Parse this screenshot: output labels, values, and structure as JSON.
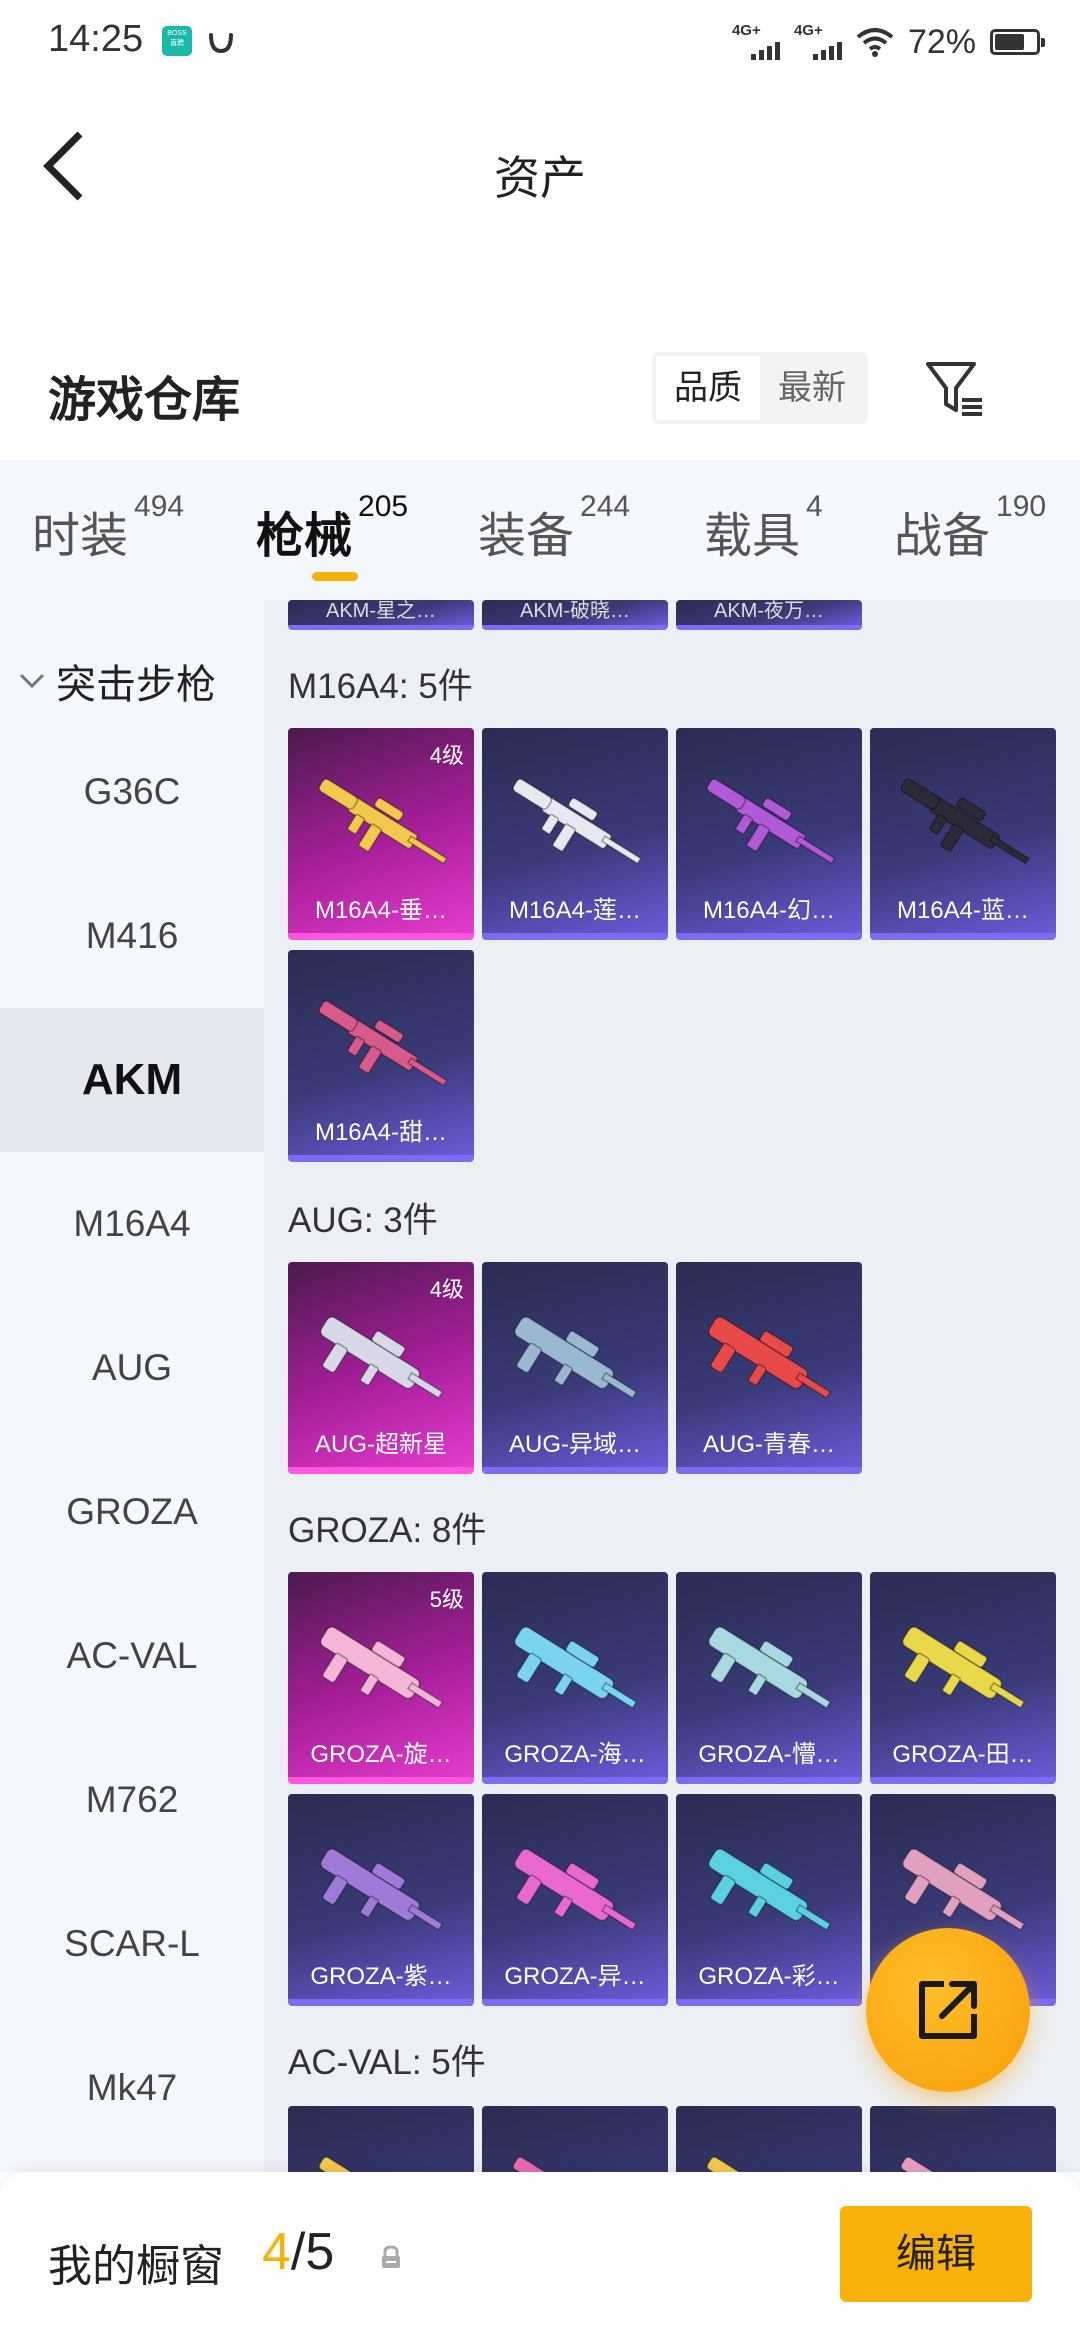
{
  "status_bar": {
    "time": "14:25",
    "app_icon_1": "BOSS直聘",
    "network_1": "4G+",
    "network_2": "4G+",
    "battery_percent": "72%",
    "battery_level": 0.72
  },
  "header": {
    "title": "资产",
    "back_icon": "chevron-left-icon"
  },
  "warehouse": {
    "title": "游戏仓库",
    "sort_options": [
      "品质",
      "最新"
    ],
    "selected_sort": "品质",
    "filter_icon": "filter-icon"
  },
  "tabs": [
    {
      "label": "时装",
      "count": "494"
    },
    {
      "label": "枪械",
      "count": "205"
    },
    {
      "label": "装备",
      "count": "244"
    },
    {
      "label": "载具",
      "count": "4"
    },
    {
      "label": "战备",
      "count": "190"
    }
  ],
  "active_tab": "枪械",
  "sidebar": {
    "category": "突击步枪",
    "items": [
      "G36C",
      "M416",
      "AKM",
      "M16A4",
      "AUG",
      "GROZA",
      "AC-VAL",
      "M762",
      "SCAR-L",
      "Mk47"
    ],
    "active": "AKM"
  },
  "content": {
    "top_partial": [
      "AKM-星之…",
      "AKM-破晓…",
      "AKM-夜万…"
    ],
    "sections": [
      {
        "title": "M16A4: 5件",
        "items": [
          {
            "name": "M16A4-垂…",
            "level": "4级",
            "rarity": "gold",
            "accent": "#f2c94c"
          },
          {
            "name": "M16A4-莲…",
            "level": "",
            "rarity": "purple",
            "accent": "#e8e8f0"
          },
          {
            "name": "M16A4-幻…",
            "level": "",
            "rarity": "purple",
            "accent": "#b05ad8"
          },
          {
            "name": "M16A4-蓝…",
            "level": "",
            "rarity": "purple",
            "accent": "#2c2a36"
          },
          {
            "name": "M16A4-甜…",
            "level": "",
            "rarity": "purple",
            "accent": "#d85a8a"
          }
        ]
      },
      {
        "title": "AUG: 3件",
        "items": [
          {
            "name": "AUG-超新星",
            "level": "4级",
            "rarity": "gold",
            "accent": "#d8d8e8"
          },
          {
            "name": "AUG-异域…",
            "level": "",
            "rarity": "purple",
            "accent": "#9ab8d0"
          },
          {
            "name": "AUG-青春…",
            "level": "",
            "rarity": "purple",
            "accent": "#e84a4a"
          }
        ]
      },
      {
        "title": "GROZA: 8件",
        "items": [
          {
            "name": "GROZA-旋…",
            "level": "5级",
            "rarity": "gold",
            "accent": "#f4b6d8"
          },
          {
            "name": "GROZA-海…",
            "level": "",
            "rarity": "purple",
            "accent": "#7ad4f0"
          },
          {
            "name": "GROZA-懵…",
            "level": "",
            "rarity": "purple",
            "accent": "#a8d8e0"
          },
          {
            "name": "GROZA-田…",
            "level": "",
            "rarity": "purple",
            "accent": "#e8d84a"
          },
          {
            "name": "GROZA-紫…",
            "level": "",
            "rarity": "purple",
            "accent": "#a07ad8"
          },
          {
            "name": "GROZA-异…",
            "level": "",
            "rarity": "purple",
            "accent": "#e86ad0"
          },
          {
            "name": "GROZA-彩…",
            "level": "",
            "rarity": "purple",
            "accent": "#5ad0e0"
          },
          {
            "name": "",
            "level": "",
            "rarity": "purple",
            "accent": "#e0a0c0"
          }
        ]
      },
      {
        "title": "AC-VAL: 5件",
        "items": [
          {
            "name": "",
            "level": "",
            "rarity": "purple",
            "accent": "#f2c94c"
          },
          {
            "name": "",
            "level": "",
            "rarity": "purple",
            "accent": "#e86ab0"
          },
          {
            "name": "",
            "level": "",
            "rarity": "purple",
            "accent": "#f2c94c"
          },
          {
            "name": "",
            "level": "",
            "rarity": "purple",
            "accent": "#e8a0c0"
          }
        ]
      }
    ]
  },
  "fab": {
    "icon": "share-external-icon"
  },
  "bottom_bar": {
    "label": "我的橱窗",
    "current": "4",
    "total": "/5",
    "lock_icon": "lock-icon",
    "edit_label": "编辑"
  },
  "colors": {
    "accent": "#f6b10a",
    "gold_card": "#e33ccd",
    "purple_card": "#6a5ad8"
  }
}
